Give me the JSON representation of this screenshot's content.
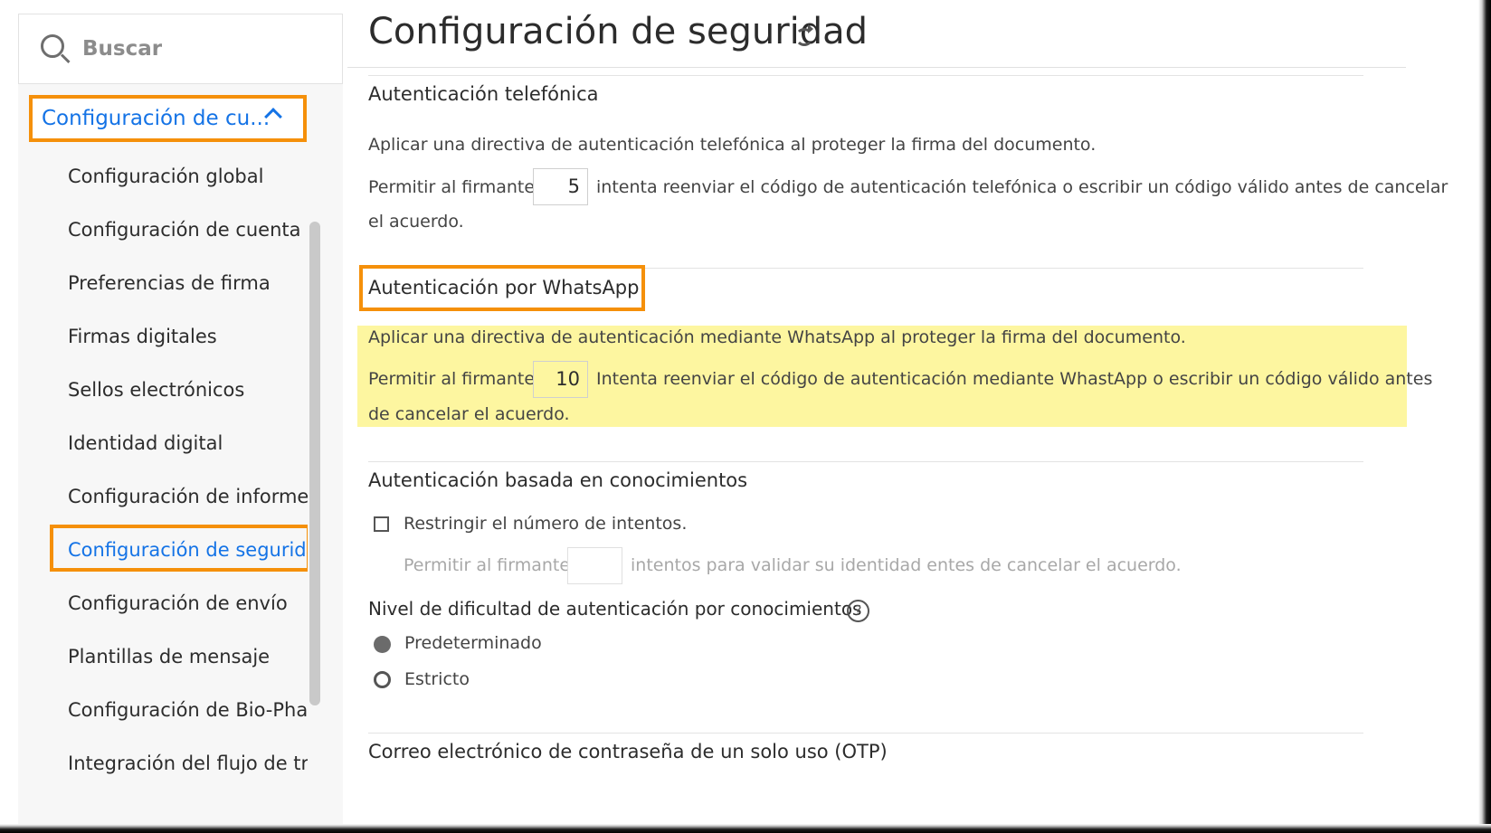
{
  "sidebar": {
    "search_placeholder": "Buscar",
    "section_header": "Configuración de cu...",
    "items": [
      {
        "label": "Configuración global"
      },
      {
        "label": "Configuración de cuenta"
      },
      {
        "label": "Preferencias de firma"
      },
      {
        "label": "Firmas digitales"
      },
      {
        "label": "Sellos electrónicos"
      },
      {
        "label": "Identidad digital"
      },
      {
        "label": "Configuración de informe"
      },
      {
        "label": "Configuración de seguridad"
      },
      {
        "label": "Configuración de envío"
      },
      {
        "label": "Plantillas de mensaje"
      },
      {
        "label": "Configuración de Bio-Pha..."
      },
      {
        "label": "Integración del flujo de tr..."
      }
    ]
  },
  "main": {
    "title": "Configuración de seguridad",
    "phone": {
      "heading": "Autenticación telefónica",
      "desc": "Aplicar una directiva de autenticación telefónica al proteger la firma del documento.",
      "allow_prefix": "Permitir al firmante",
      "value": "5",
      "allow_suffix": "intenta reenviar el código de autenticación telefónica o escribir un código válido antes de cancelar",
      "allow_end": "el acuerdo."
    },
    "whatsapp": {
      "heading": "Autenticación por WhatsApp",
      "desc": "Aplicar una directiva de autenticación mediante WhatsApp al proteger la firma del documento.",
      "allow_prefix": "Permitir al firmante",
      "value": "10",
      "allow_suffix": "Intenta reenviar el código de autenticación mediante WhastApp o escribir un código válido antes",
      "allow_end": "de cancelar el acuerdo."
    },
    "kba": {
      "heading": "Autenticación basada en conocimientos",
      "restrict_label": "Restringir el número de intentos.",
      "allow_prefix": "Permitir al firmante",
      "allow_suffix": "intentos para validar su identidad entes de cancelar el acuerdo.",
      "difficulty_heading": "Nivel de dificultad de autenticación por conocimientos",
      "help": "?",
      "option_default": "Predeterminado",
      "option_strict": "Estricto"
    },
    "otp": {
      "heading": "Correo electrónico de contraseña de un solo uso (OTP)"
    }
  }
}
